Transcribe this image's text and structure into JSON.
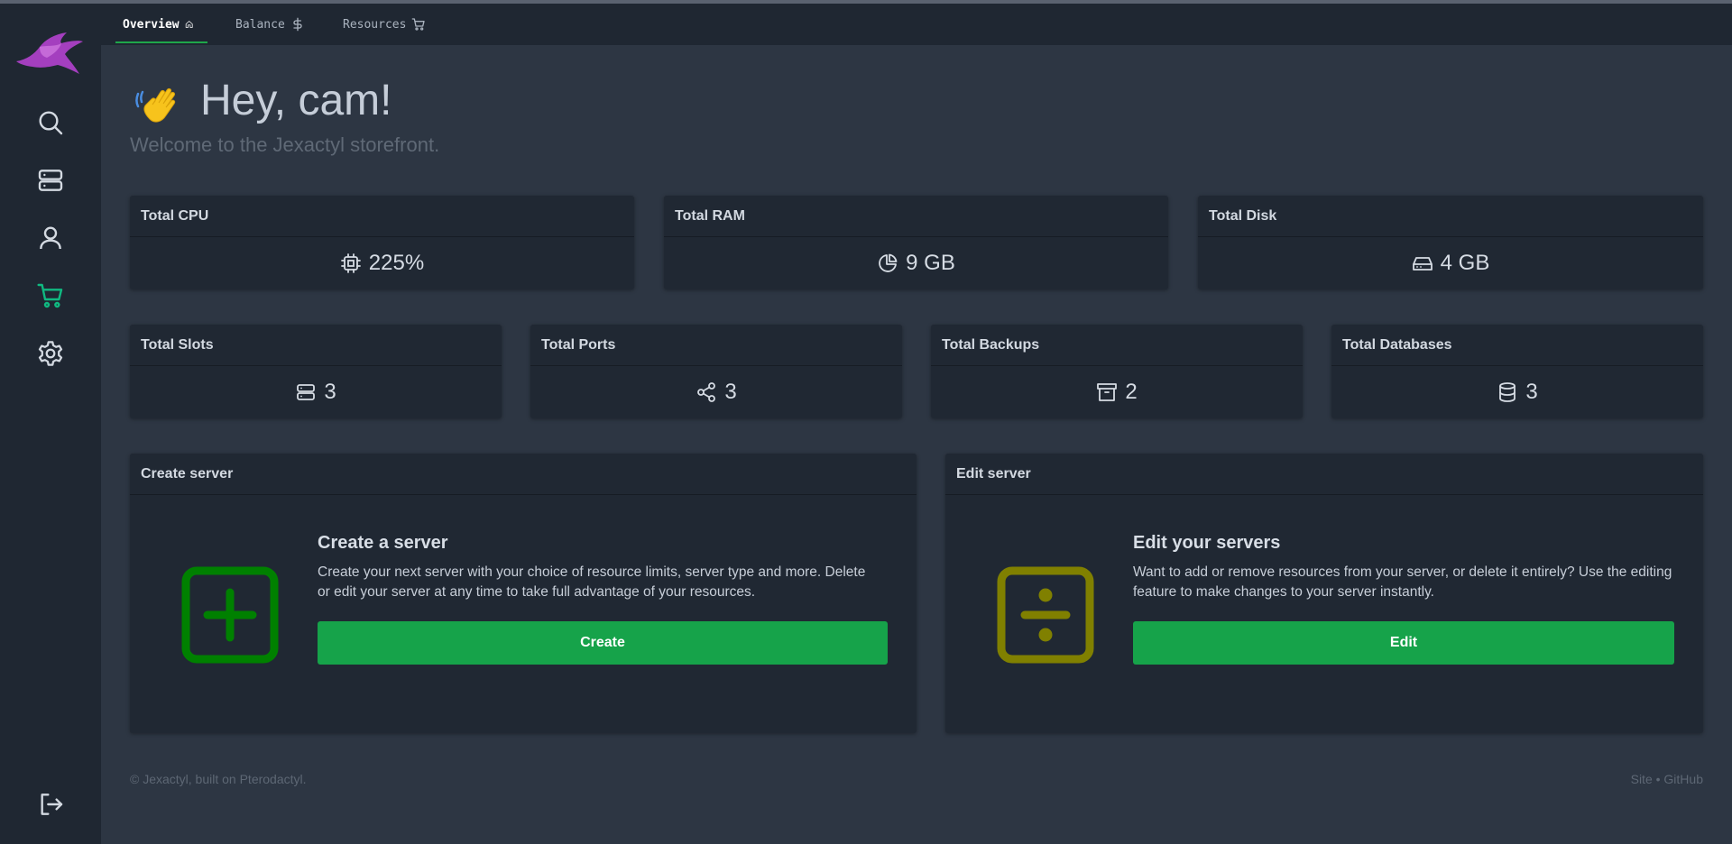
{
  "tabs": [
    {
      "label": "Overview",
      "icon": "home-icon",
      "active": true
    },
    {
      "label": "Balance",
      "icon": "dollar-icon",
      "active": false
    },
    {
      "label": "Resources",
      "icon": "cart-icon",
      "active": false
    }
  ],
  "sidebar": {
    "items": [
      {
        "name": "search",
        "icon": "search-icon"
      },
      {
        "name": "servers",
        "icon": "server-icon"
      },
      {
        "name": "account",
        "icon": "user-icon"
      },
      {
        "name": "store",
        "icon": "cart-icon",
        "active": true
      },
      {
        "name": "settings",
        "icon": "gear-icon"
      }
    ],
    "logout_icon": "logout-icon"
  },
  "greeting": {
    "title": "Hey, cam!",
    "subtitle": "Welcome to the Jexactyl storefront."
  },
  "stats_row1": [
    {
      "label": "Total CPU",
      "value": "225%",
      "icon": "cpu-icon"
    },
    {
      "label": "Total RAM",
      "value": "9 GB",
      "icon": "pie-chart-icon"
    },
    {
      "label": "Total Disk",
      "value": "4 GB",
      "icon": "hard-drive-icon"
    }
  ],
  "stats_row2": [
    {
      "label": "Total Slots",
      "value": "3",
      "icon": "server-icon"
    },
    {
      "label": "Total Ports",
      "value": "3",
      "icon": "share-icon"
    },
    {
      "label": "Total Backups",
      "value": "2",
      "icon": "archive-icon"
    },
    {
      "label": "Total Databases",
      "value": "3",
      "icon": "database-icon"
    }
  ],
  "create_card": {
    "header": "Create server",
    "title": "Create a server",
    "text": "Create your next server with your choice of resource limits, server type and more. Delete or edit your server at any time to take full advantage of your resources.",
    "button": "Create",
    "icon_color": "#008000"
  },
  "edit_card": {
    "header": "Edit server",
    "title": "Edit your servers",
    "text": "Want to add or remove resources from your server, or delete it entirely? Use the editing feature to make changes to your server instantly.",
    "button": "Edit",
    "icon_color": "#808000"
  },
  "footer": {
    "left": "© Jexactyl, built on Pterodactyl.",
    "right": "Site • GitHub"
  },
  "colors": {
    "accent": "#16a34a",
    "active_nav": "#10b981",
    "sidebar_bg": "#1f2732",
    "page_bg": "#2d3643"
  }
}
